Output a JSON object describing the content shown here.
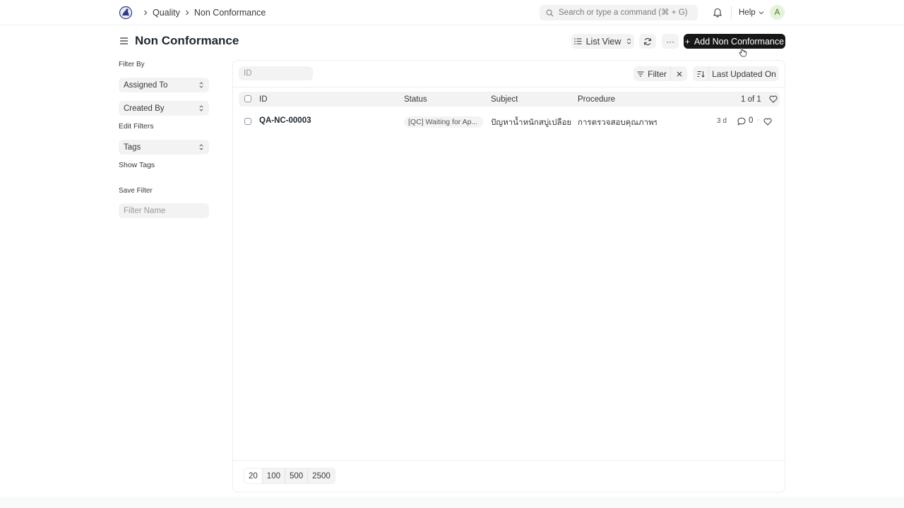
{
  "navbar": {
    "breadcrumbs": [
      "Quality",
      "Non Conformance"
    ],
    "search_placeholder": "Search or type a command (⌘ + G)",
    "help_label": "Help",
    "avatar_initial": "A"
  },
  "page": {
    "title": "Non Conformance",
    "list_view_label": "List View",
    "more_label": "···",
    "add_button_label": "Add Non Conformance",
    "add_button_plus": "+"
  },
  "sidebar": {
    "filter_by_label": "Filter By",
    "assigned_to_label": "Assigned To",
    "created_by_label": "Created By",
    "edit_filters_label": "Edit Filters",
    "tags_label": "Tags",
    "show_tags_label": "Show Tags",
    "save_filter_label": "Save Filter",
    "filter_name_placeholder": "Filter Name"
  },
  "list": {
    "id_placeholder": "ID",
    "filter_label": "Filter",
    "sort_label": "Last Updated On",
    "columns": {
      "id": "ID",
      "status": "Status",
      "subject": "Subject",
      "procedure": "Procedure"
    },
    "count_label": "1 of 1",
    "rows": [
      {
        "id": "QA-NC-00003",
        "status": "[QC] Waiting for Ap...",
        "subject": "ปัญหาน้ำหนักสบู่เปลือย...",
        "procedure": "การตรวจสอบคุณภาพร...",
        "time": "3 d",
        "comments": "0",
        "dot": "·"
      }
    ],
    "page_sizes": [
      "20",
      "100",
      "500",
      "2500"
    ]
  },
  "colors": {
    "primary_button": "#171717",
    "control_bg": "#f3f3f3",
    "border": "#ebeef0",
    "avatar_bg": "#e6f2dc"
  }
}
